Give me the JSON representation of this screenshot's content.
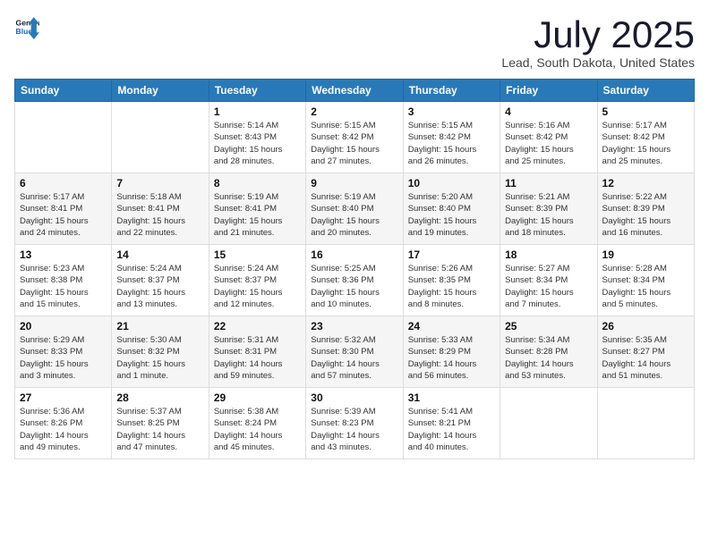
{
  "logo": {
    "general": "General",
    "blue": "Blue"
  },
  "title": "July 2025",
  "location": "Lead, South Dakota, United States",
  "weekdays": [
    "Sunday",
    "Monday",
    "Tuesday",
    "Wednesday",
    "Thursday",
    "Friday",
    "Saturday"
  ],
  "weeks": [
    [
      {
        "day": "",
        "info": ""
      },
      {
        "day": "",
        "info": ""
      },
      {
        "day": "1",
        "info": "Sunrise: 5:14 AM\nSunset: 8:43 PM\nDaylight: 15 hours\nand 28 minutes."
      },
      {
        "day": "2",
        "info": "Sunrise: 5:15 AM\nSunset: 8:42 PM\nDaylight: 15 hours\nand 27 minutes."
      },
      {
        "day": "3",
        "info": "Sunrise: 5:15 AM\nSunset: 8:42 PM\nDaylight: 15 hours\nand 26 minutes."
      },
      {
        "day": "4",
        "info": "Sunrise: 5:16 AM\nSunset: 8:42 PM\nDaylight: 15 hours\nand 25 minutes."
      },
      {
        "day": "5",
        "info": "Sunrise: 5:17 AM\nSunset: 8:42 PM\nDaylight: 15 hours\nand 25 minutes."
      }
    ],
    [
      {
        "day": "6",
        "info": "Sunrise: 5:17 AM\nSunset: 8:41 PM\nDaylight: 15 hours\nand 24 minutes."
      },
      {
        "day": "7",
        "info": "Sunrise: 5:18 AM\nSunset: 8:41 PM\nDaylight: 15 hours\nand 22 minutes."
      },
      {
        "day": "8",
        "info": "Sunrise: 5:19 AM\nSunset: 8:41 PM\nDaylight: 15 hours\nand 21 minutes."
      },
      {
        "day": "9",
        "info": "Sunrise: 5:19 AM\nSunset: 8:40 PM\nDaylight: 15 hours\nand 20 minutes."
      },
      {
        "day": "10",
        "info": "Sunrise: 5:20 AM\nSunset: 8:40 PM\nDaylight: 15 hours\nand 19 minutes."
      },
      {
        "day": "11",
        "info": "Sunrise: 5:21 AM\nSunset: 8:39 PM\nDaylight: 15 hours\nand 18 minutes."
      },
      {
        "day": "12",
        "info": "Sunrise: 5:22 AM\nSunset: 8:39 PM\nDaylight: 15 hours\nand 16 minutes."
      }
    ],
    [
      {
        "day": "13",
        "info": "Sunrise: 5:23 AM\nSunset: 8:38 PM\nDaylight: 15 hours\nand 15 minutes."
      },
      {
        "day": "14",
        "info": "Sunrise: 5:24 AM\nSunset: 8:37 PM\nDaylight: 15 hours\nand 13 minutes."
      },
      {
        "day": "15",
        "info": "Sunrise: 5:24 AM\nSunset: 8:37 PM\nDaylight: 15 hours\nand 12 minutes."
      },
      {
        "day": "16",
        "info": "Sunrise: 5:25 AM\nSunset: 8:36 PM\nDaylight: 15 hours\nand 10 minutes."
      },
      {
        "day": "17",
        "info": "Sunrise: 5:26 AM\nSunset: 8:35 PM\nDaylight: 15 hours\nand 8 minutes."
      },
      {
        "day": "18",
        "info": "Sunrise: 5:27 AM\nSunset: 8:34 PM\nDaylight: 15 hours\nand 7 minutes."
      },
      {
        "day": "19",
        "info": "Sunrise: 5:28 AM\nSunset: 8:34 PM\nDaylight: 15 hours\nand 5 minutes."
      }
    ],
    [
      {
        "day": "20",
        "info": "Sunrise: 5:29 AM\nSunset: 8:33 PM\nDaylight: 15 hours\nand 3 minutes."
      },
      {
        "day": "21",
        "info": "Sunrise: 5:30 AM\nSunset: 8:32 PM\nDaylight: 15 hours\nand 1 minute."
      },
      {
        "day": "22",
        "info": "Sunrise: 5:31 AM\nSunset: 8:31 PM\nDaylight: 14 hours\nand 59 minutes."
      },
      {
        "day": "23",
        "info": "Sunrise: 5:32 AM\nSunset: 8:30 PM\nDaylight: 14 hours\nand 57 minutes."
      },
      {
        "day": "24",
        "info": "Sunrise: 5:33 AM\nSunset: 8:29 PM\nDaylight: 14 hours\nand 56 minutes."
      },
      {
        "day": "25",
        "info": "Sunrise: 5:34 AM\nSunset: 8:28 PM\nDaylight: 14 hours\nand 53 minutes."
      },
      {
        "day": "26",
        "info": "Sunrise: 5:35 AM\nSunset: 8:27 PM\nDaylight: 14 hours\nand 51 minutes."
      }
    ],
    [
      {
        "day": "27",
        "info": "Sunrise: 5:36 AM\nSunset: 8:26 PM\nDaylight: 14 hours\nand 49 minutes."
      },
      {
        "day": "28",
        "info": "Sunrise: 5:37 AM\nSunset: 8:25 PM\nDaylight: 14 hours\nand 47 minutes."
      },
      {
        "day": "29",
        "info": "Sunrise: 5:38 AM\nSunset: 8:24 PM\nDaylight: 14 hours\nand 45 minutes."
      },
      {
        "day": "30",
        "info": "Sunrise: 5:39 AM\nSunset: 8:23 PM\nDaylight: 14 hours\nand 43 minutes."
      },
      {
        "day": "31",
        "info": "Sunrise: 5:41 AM\nSunset: 8:21 PM\nDaylight: 14 hours\nand 40 minutes."
      },
      {
        "day": "",
        "info": ""
      },
      {
        "day": "",
        "info": ""
      }
    ]
  ]
}
